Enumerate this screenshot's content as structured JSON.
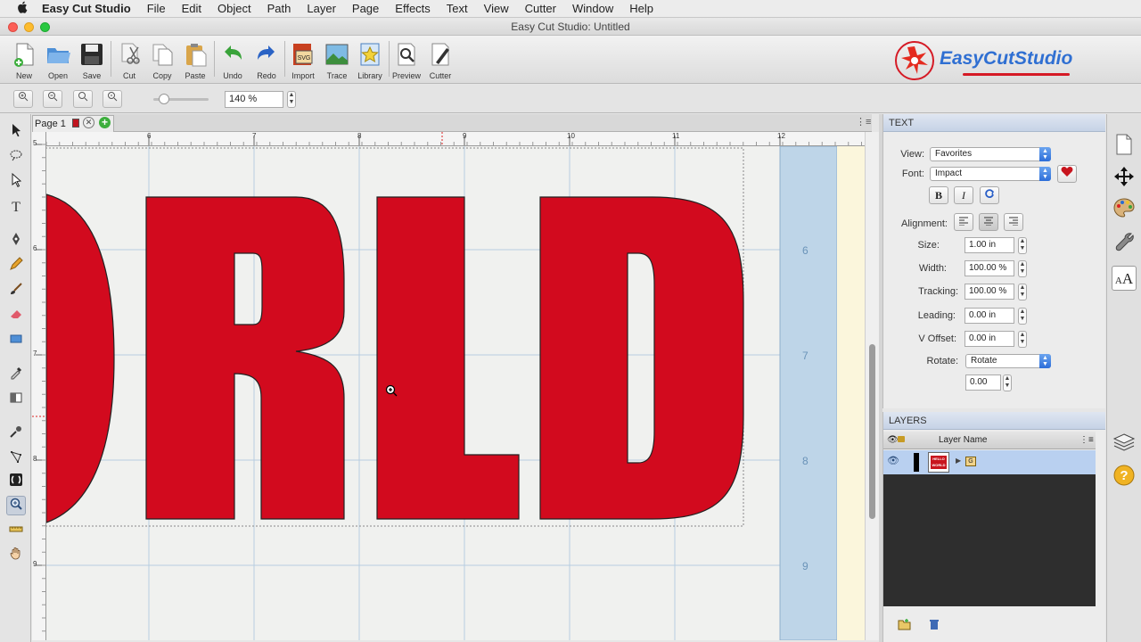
{
  "menubar": {
    "apple": "",
    "app_name": "Easy Cut Studio",
    "items": [
      "File",
      "Edit",
      "Object",
      "Path",
      "Layer",
      "Page",
      "Effects",
      "Text",
      "View",
      "Cutter",
      "Window",
      "Help"
    ]
  },
  "window": {
    "title": "Easy Cut Studio: Untitled"
  },
  "toolbar": {
    "buttons": [
      {
        "label": "New",
        "icon": "new-document-icon"
      },
      {
        "label": "Open",
        "icon": "open-folder-icon"
      },
      {
        "label": "Save",
        "icon": "save-disk-icon"
      },
      {
        "label": "Cut",
        "icon": "scissors-icon"
      },
      {
        "label": "Copy",
        "icon": "copy-icon"
      },
      {
        "label": "Paste",
        "icon": "paste-clipboard-icon"
      },
      {
        "label": "Undo",
        "icon": "undo-arrow-icon"
      },
      {
        "label": "Redo",
        "icon": "redo-arrow-icon"
      },
      {
        "label": "Import",
        "icon": "import-svg-icon"
      },
      {
        "label": "Trace",
        "icon": "trace-image-icon"
      },
      {
        "label": "Library",
        "icon": "library-star-icon"
      },
      {
        "label": "Preview",
        "icon": "preview-magnifier-icon"
      },
      {
        "label": "Cutter",
        "icon": "cutter-blade-icon"
      }
    ],
    "logo_text": "EasyCutStudio"
  },
  "zoombar": {
    "zoom_value": "140 %",
    "zoom_slider_level": 0.2
  },
  "document": {
    "page_tab_label": "Page 1",
    "ruler_h_labels": [
      "6",
      "7",
      "8",
      "9",
      "10",
      "11",
      "12"
    ],
    "ruler_v_labels": [
      "5",
      "6",
      "7",
      "8",
      "9"
    ],
    "side_ruler_labels": [
      "6",
      "7",
      "8",
      "9"
    ],
    "canvas_text": "ORLD",
    "text_fill": "#d20a1e"
  },
  "text_panel": {
    "title": "TEXT",
    "view_label": "View:",
    "view_value": "Favorites",
    "font_label": "Font:",
    "font_value": "Impact",
    "bold": "B",
    "italic": "I",
    "alignment_label": "Alignment:",
    "size_label": "Size:",
    "size_value": "1.00 in",
    "width_label": "Width:",
    "width_value": "100.00 %",
    "tracking_label": "Tracking:",
    "tracking_value": "100.00 %",
    "leading_label": "Leading:",
    "leading_value": "0.00 in",
    "voffset_label": "V Offset:",
    "voffset_value": "0.00 in",
    "rotate_label": "Rotate:",
    "rotate_value": "Rotate",
    "rotate_angle": "0.00"
  },
  "layers_panel": {
    "title": "LAYERS",
    "col_name": "Layer Name",
    "thumb_text": "HELLO WORLD",
    "group_label": "G"
  },
  "colors": {
    "accent_blue": "#3a78de",
    "selected_layer": "#b9d0f0",
    "page_blue_margin": "#bed5e8"
  }
}
